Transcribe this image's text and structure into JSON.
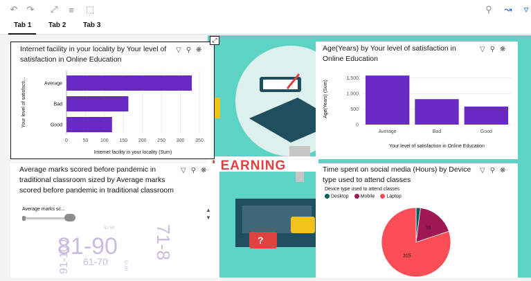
{
  "toolbar": {
    "left_icons": [
      "undo-icon",
      "redo-icon",
      "expand-icon",
      "bar-align-icon",
      "select-icon"
    ],
    "right_icons": [
      "zoom-icon",
      "line-chart-icon",
      "filter-icon"
    ]
  },
  "tabs": [
    {
      "label": "Tab 1",
      "active": true
    },
    {
      "label": "Tab 2",
      "active": false
    },
    {
      "label": "Tab 3",
      "active": false
    }
  ],
  "background": {
    "banner_text": "LEARNING",
    "qmark": "?"
  },
  "panels": {
    "p1": {
      "title": "Internet facility in your locality by Your level of satisfaction in Online Education",
      "selected": true
    },
    "p2": {
      "title": "Age(Years) by Your level of satisfaction in Online Education"
    },
    "p3": {
      "title": "Average marks scored before pandemic in traditional classroom sized by Average marks scored before pandemic in traditional classroom",
      "slider_label": "Average marks sc...",
      "words": [
        {
          "text": "81-90",
          "size": 34,
          "color": "#c9bce0"
        },
        {
          "text": "71-8",
          "size": 26,
          "color": "#c9bce0"
        },
        {
          "text": "91-100",
          "size": 16,
          "color": "#c9bce0"
        },
        {
          "text": "61-70",
          "size": 14,
          "color": "#c9bce0"
        },
        {
          "text": "51-60",
          "size": 6,
          "color": "#c9bce0"
        },
        {
          "text": "41-50",
          "size": 6,
          "color": "#c9bce0"
        }
      ]
    },
    "p4": {
      "title": "Time spent on social media (Hours) by Device type used to attend classes",
      "legend_title": "Device type used to attend classes"
    }
  },
  "chart_data": [
    {
      "type": "bar",
      "orientation": "horizontal",
      "categories": [
        "Average",
        "Bad",
        "Good"
      ],
      "values": [
        330,
        163,
        120
      ],
      "xlabel": "Internet facility in your locality (Sum)",
      "ylabel": "Your level of satisfacti...",
      "xlim": [
        0,
        350
      ],
      "xticks": [
        0,
        50,
        100,
        150,
        200,
        250,
        300,
        350
      ],
      "color": "#6929c4",
      "grid": true
    },
    {
      "type": "bar",
      "orientation": "vertical",
      "categories": [
        "Average",
        "Bad",
        "Good"
      ],
      "values": [
        1580,
        820,
        580
      ],
      "xlabel": "Your level of satisfaction in Online Education",
      "ylabel": "Age(Years) (Sum)",
      "ylim": [
        0,
        1500
      ],
      "yticks": [
        "0",
        "500",
        "1,000",
        "1,500"
      ],
      "ytick_values": [
        0,
        500,
        1000,
        1500
      ],
      "color": "#6929c4",
      "grid": true
    },
    {
      "type": "pie",
      "labels": [
        "Desktop",
        "Mobile",
        "Laptop"
      ],
      "values": [
        8,
        70,
        315
      ],
      "colors": [
        "#005d5d",
        "#9f1853",
        "#fa4d56"
      ],
      "data_labels": [
        "",
        "70",
        "315"
      ],
      "legend_title": "Device type used to attend classes",
      "legend": "top-left"
    }
  ]
}
